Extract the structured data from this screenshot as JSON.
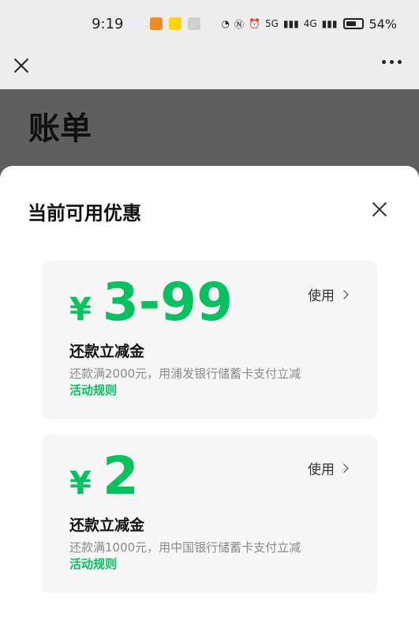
{
  "status_bar": {
    "time": "9:19",
    "network_5g": "5G",
    "network_4g": "4G",
    "battery_pct": "54%"
  },
  "nav": {
    "close_icon": "close-icon",
    "more_icon": "more-icon"
  },
  "page": {
    "title": "账单"
  },
  "sheet": {
    "title": "当前可用优惠",
    "coupons": [
      {
        "currency": "¥",
        "value": "3-99",
        "use_label": "使用",
        "name": "还款立减金",
        "desc": "还款满2000元，用浦发银行储蓄卡支付立减",
        "rule_label": "活动规则"
      },
      {
        "currency": "¥",
        "value": "2",
        "use_label": "使用",
        "name": "还款立减金",
        "desc": "还款满1000元，用中国银行储蓄卡支付立减",
        "rule_label": "活动规则"
      }
    ]
  },
  "colors": {
    "accent": "#07c160",
    "status_bg": "#ededed",
    "overlay": "#5f5f5f"
  }
}
